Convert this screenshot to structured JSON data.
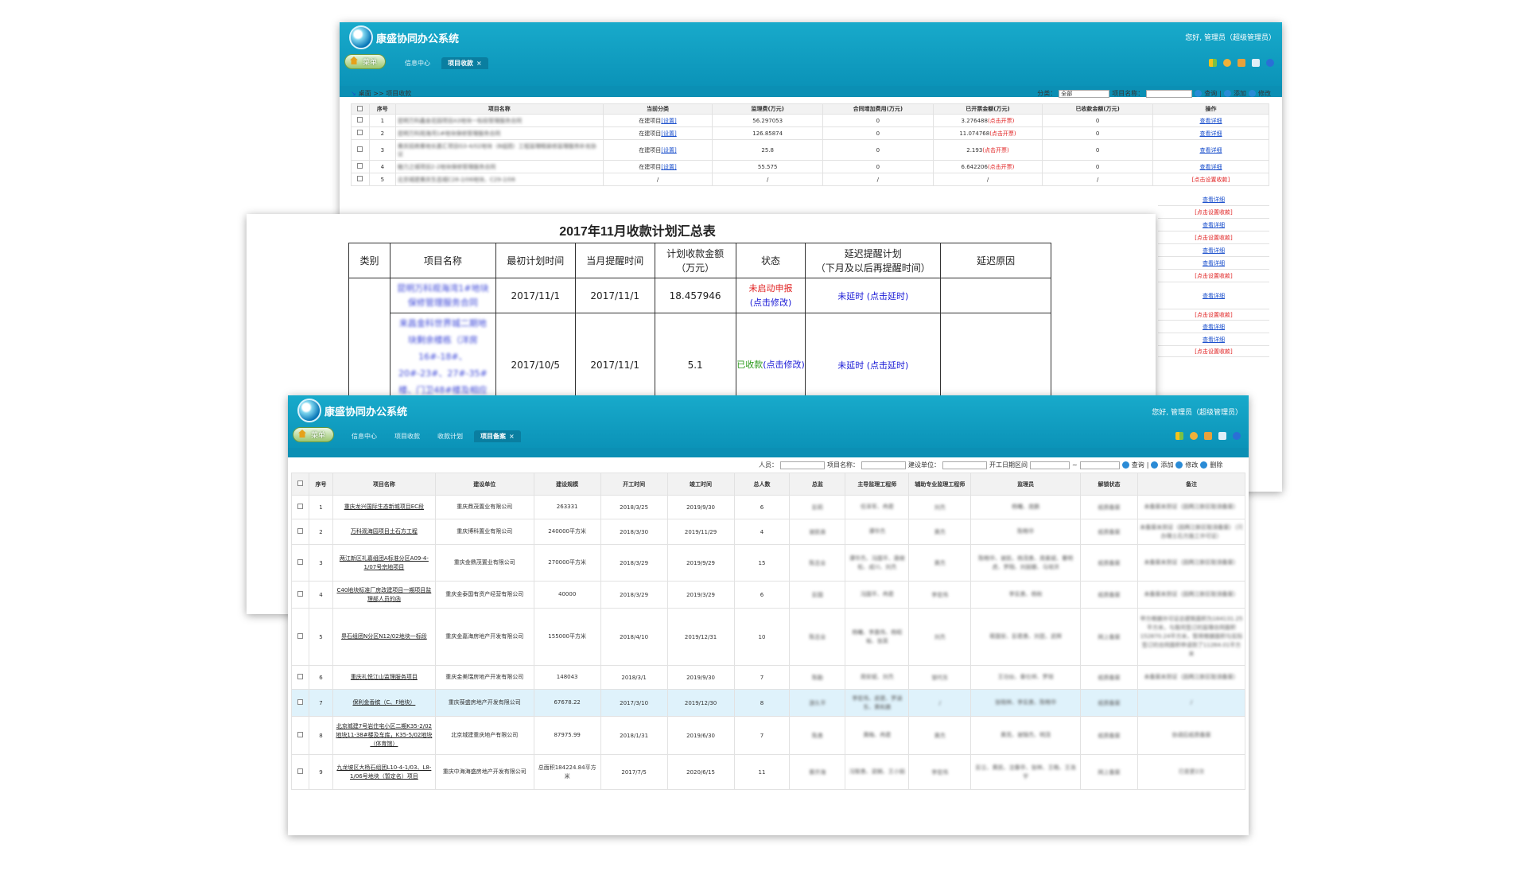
{
  "app": {
    "title": "康盛协同办公系统",
    "greeting": "您好, 管理员（超级管理员）",
    "menu_label": "菜单"
  },
  "back": {
    "tabs": [
      {
        "label": "信息中心",
        "active": false
      },
      {
        "label": "项目收款",
        "active": true
      }
    ],
    "breadcrumb": "桌面 >> 项目收款",
    "filter": {
      "category_label": "分类：",
      "category_value": "全部",
      "name_label": "项目名称：",
      "search": "查询",
      "add": "添加",
      "edit": "修改"
    },
    "headers": [
      "序号",
      "项目名称",
      "当前分类",
      "监理费(万元)",
      "合同增加费用(万元)",
      "已开票金额(万元)",
      "已收款金额(万元)",
      "操作"
    ],
    "rows": [
      {
        "no": "1",
        "name": "昆明万科鑫金花园项目A3地块一标段管理服务合同",
        "cat": "在建项目",
        "cat_link": "[设置]",
        "fee": "56.297053",
        "add": "0",
        "inv": "3.276488",
        "inv_link": "(点击开票)",
        "recv": "0",
        "op": "查看详细",
        "op_red": false
      },
      {
        "no": "2",
        "name": "昆明万科观海湾1#地块保修管理服务合同",
        "cat": "在建项目",
        "cat_link": "[设置]",
        "fee": "126.85874",
        "add": "0",
        "inv": "11.074768",
        "inv_link": "(点击开票)",
        "recv": "0",
        "op": "查看详细",
        "op_red": false
      },
      {
        "no": "3",
        "name": "重庆招商重地长嘉汇项目G3-4/02地块（B组团）工程监理精装修监理服务补充协议",
        "cat": "在建项目",
        "cat_link": "[设置]",
        "fee": "25.8",
        "add": "0",
        "inv": "2.193",
        "inv_link": "(点击开票)",
        "recv": "0",
        "op": "查看详细",
        "op_red": false
      },
      {
        "no": "4",
        "name": "魅力之城项目2-2地块保修管理服务合同",
        "cat": "在建项目",
        "cat_link": "[设置]",
        "fee": "55.575",
        "add": "0",
        "inv": "6.642206",
        "inv_link": "(点击开票)",
        "recv": "0",
        "op": "查看详细",
        "op_red": false
      },
      {
        "no": "5",
        "name": "北京城建重庆生态城C28-2/06地块、C29-2/06",
        "cat": "/",
        "cat_link": "",
        "fee": "/",
        "add": "/",
        "inv": "/",
        "inv_link": "",
        "recv": "/",
        "op": "[点击设置收款]",
        "op_red": true
      }
    ],
    "ops_more": [
      "查看详细",
      "[点击设置收款]",
      "查看详细",
      "[点击设置收款]",
      "查看详细",
      "查看详细",
      "[点击设置收款]",
      "查看详细",
      "[点击设置收款]",
      "查看详细",
      "查看详细",
      "[点击设置收款]"
    ]
  },
  "summary": {
    "title": "2017年11月收款计划汇总表",
    "headers": [
      "类别",
      "项目名称",
      "最初计划时间",
      "当月提醒时间",
      "计划收款金额\n（万元）",
      "状态",
      "延迟提醒计划\n（下月及以后再提醒时间）",
      "延迟原因"
    ],
    "rows": [
      {
        "name": "昆明万科观海湾1#地块保修管理服务合同",
        "first": "2017/11/1",
        "remind": "2017/11/1",
        "amount": "18.457946",
        "status": "未启动申报",
        "status_link": "(点击修改)",
        "status_type": "red",
        "delay": "未延时",
        "delay_link": "(点击延时)"
      },
      {
        "name": "来昌金科世界城二期地块剩余楼栋（洋房16#-18#、20#-23#、27#-35#楼、门卫48#楼及相应44#楼车库）监理工程",
        "first": "2017/10/5",
        "remind": "2017/11/1",
        "amount": "5.1",
        "status": "已收款",
        "status_link": "(点击修改)",
        "status_type": "green",
        "delay": "未延时",
        "delay_link": "(点击延时)"
      }
    ]
  },
  "front": {
    "tabs": [
      {
        "label": "信息中心",
        "active": false
      },
      {
        "label": "项目收款",
        "active": false
      },
      {
        "label": "收款计划",
        "active": false
      },
      {
        "label": "项目备案",
        "active": true
      }
    ],
    "filter": {
      "person": "人员：",
      "name": "项目名称：",
      "builder": "建设单位：",
      "interval": "开工日期区间",
      "tilde": "~",
      "search": "查询",
      "add": "添加",
      "edit": "修改",
      "delete": "删除"
    },
    "headers": [
      "序号",
      "项目名称",
      "建设单位",
      "建设规模",
      "开工时间",
      "竣工时间",
      "总人数",
      "总监",
      "主导监理工程师",
      "辅助专业监理工程师",
      "监理员",
      "解锁状态",
      "备注"
    ],
    "rows": [
      {
        "no": "1",
        "name": "重庆龙兴国际生态新城项目EC段",
        "unit": "重庆鼎茂置业有限公司",
        "scale": "263331",
        "start": "2018/3/25",
        "end": "2019/9/30",
        "count": "6",
        "chief": "彭莉",
        "lead": "任泽军、冉君",
        "assist": "刘杰",
        "staff": "杨曦、庞鹏",
        "lock": "纸质备案",
        "note": "未备案未到证（因两江新区取消备案）",
        "hl": false
      },
      {
        "no": "2",
        "name": "万科观海园项目土石方工程",
        "unit": "重庆博科置业有限公司",
        "scale": "240000平方米",
        "start": "2018/3/30",
        "end": "2019/11/29",
        "count": "4",
        "chief": "谢凯善",
        "lead": "谭华杰",
        "assist": "黄杰",
        "staff": "陈畅华",
        "lock": "纸质备案",
        "note": "未备案未到证（因两江新区取消备案）（只办理土石方施工许可证）",
        "hl": false
      },
      {
        "no": "3",
        "name": "两江新区礼嘉组团A标准分区A09-4-1/07号宗地项目",
        "unit": "重庆金鼎茂置业有限公司",
        "scale": "270000平方米",
        "start": "2018/3/29",
        "end": "2019/9/29",
        "count": "15",
        "chief": "陈志全",
        "lead": "谭华杰、冯国平、唐继松、成川、刘杰",
        "assist": "黄杰",
        "staff": "陈畅华、谢凯、杨茂勇、周素斌、曹明虎、罗翔、刘丽娜、马培洪",
        "lock": "纸质备案",
        "note": "未备案未到证（因两江新区取消备案）",
        "hl": false
      },
      {
        "no": "4",
        "name": "C40地块标准厂房改建项目一期项目监理部人员的函",
        "unit": "重庆金泰国有资产经营有限公司",
        "scale": "40000",
        "start": "2018/3/29",
        "end": "2019/3/29",
        "count": "6",
        "chief": "彭国",
        "lead": "冯国平、冉君",
        "assist": "李宏伟",
        "staff": "李实勇、杨秋",
        "lock": "纸质备案",
        "note": "未备案未到证（因两江新区取消备案）",
        "hl": false
      },
      {
        "no": "5",
        "name": "界石组团N分区N12/02地块一标段",
        "unit": "重庆金嘉海房地产开发有限公司",
        "scale": "155000平方米",
        "start": "2018/4/10",
        "end": "2019/12/31",
        "count": "10",
        "chief": "陈志全",
        "lead": "杨曦、李嘉伟、杨昭裕、张英",
        "assist": "刘杰",
        "staff": "蒋国安、彭君勇、刘昆、武辉",
        "lock": "网上备案",
        "note": "甲方根据许可证总建筑面积为164131.25平方米，与我司签订的监理合同面积152870.24平方米，暂将根据面积与实际签订的合同面积申请到了11264.01平方米",
        "hl": false
      },
      {
        "no": "6",
        "name": "重庆礼悦江山监理服务项目",
        "unit": "重庆金美瑞房地产开发有限公司",
        "scale": "148043",
        "start": "2018/3/1",
        "end": "2019/9/30",
        "count": "7",
        "chief": "陈勤",
        "lead": "周安斌、刘杰",
        "assist": "邹代东",
        "staff": "王功伙、秦仕祥、罗旭",
        "lock": "纸质备案",
        "note": "未备案未到证（因两江新区取消备案）",
        "hl": false
      },
      {
        "no": "7",
        "name": "保利金香槟（C、F地块）",
        "unit": "重庆葆盛房地产开发有限公司",
        "scale": "67678.22",
        "start": "2017/3/10",
        "end": "2019/12/30",
        "count": "8",
        "chief": "游久平",
        "lead": "李宏伟、皮建、罗涵东、黄和晨",
        "assist": "/",
        "staff": "张晓林、李实勇、陈畅华",
        "lock": "纸质备案",
        "note": "/",
        "hl": true
      },
      {
        "no": "8",
        "name": "北京城建7号岩住宅小区二期K35-2/02地块11-38#楼及车库，K35-5/02地块（体育馆）",
        "unit": "北京城建重庆地产有限公司",
        "scale": "87975.99",
        "start": "2018/1/31",
        "end": "2019/6/30",
        "count": "7",
        "chief": "陈勇",
        "lead": "黄梅、冉君",
        "assist": "黄杰",
        "staff": "黄亮、谢锦杰、明茂",
        "lock": "纸质备案",
        "note": "协调后纸质备案",
        "hl": false
      },
      {
        "no": "9",
        "name": "九龙坡区大杨石组团L10-4-1/03、L8-1/06号地块（暂定名）项目",
        "unit": "重庆中海海盛房地产开发有限公司",
        "scale": "总面积184224.84平方米",
        "start": "2017/7/5",
        "end": "2020/6/15",
        "count": "11",
        "chief": "蔡开海",
        "lead": "冯智勇、梁娴、王小娟",
        "assist": "李宏伟",
        "staff": "彭立、黄凯、沈春亭、张林、王皓、王浩宇",
        "lock": "网上备案",
        "note": "已变更2次",
        "hl": false
      }
    ]
  },
  "colors": {
    "header_bg": "#0b93b8",
    "link": "#1a4fcc",
    "red": "#e02020",
    "green": "#2a9a1a"
  }
}
